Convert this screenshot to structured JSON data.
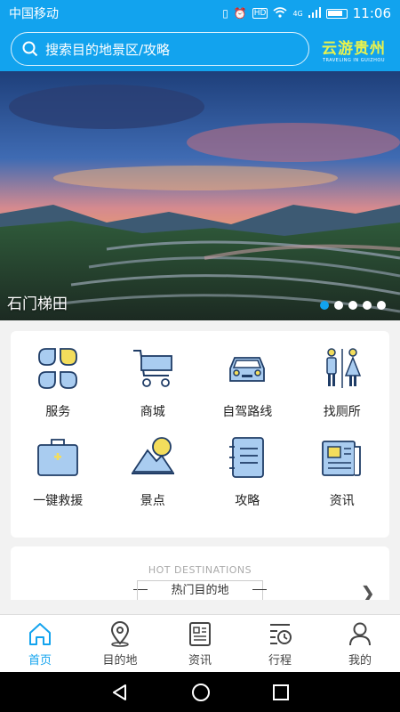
{
  "status": {
    "carrier": "中国移动",
    "time": "11:06",
    "hd": "HD",
    "net": "4G"
  },
  "search": {
    "placeholder": "搜索目的地景区/攻略"
  },
  "brand": {
    "name": "云游贵州",
    "tagline": "TRAVELING IN GUIZHOU"
  },
  "banner": {
    "caption": "石门梯田",
    "dot_count": 5,
    "active_dot": 0
  },
  "services": [
    {
      "label": "服务",
      "icon": "services-icon"
    },
    {
      "label": "商城",
      "icon": "cart-icon"
    },
    {
      "label": "自驾路线",
      "icon": "car-icon"
    },
    {
      "label": "找厕所",
      "icon": "restroom-icon"
    },
    {
      "label": "一键救援",
      "icon": "first-aid-icon"
    },
    {
      "label": "景点",
      "icon": "mountain-icon"
    },
    {
      "label": "攻略",
      "icon": "notebook-icon"
    },
    {
      "label": "资讯",
      "icon": "news-icon"
    }
  ],
  "hot": {
    "en": "HOT DESTINATIONS",
    "zh": "热门目的地"
  },
  "tabs": [
    {
      "label": "首页",
      "icon": "home-icon",
      "active": true
    },
    {
      "label": "目的地",
      "icon": "location-icon",
      "active": false
    },
    {
      "label": "资讯",
      "icon": "news-icon",
      "active": false
    },
    {
      "label": "行程",
      "icon": "itinerary-icon",
      "active": false
    },
    {
      "label": "我的",
      "icon": "profile-icon",
      "active": false
    }
  ],
  "colors": {
    "primary": "#12a3ee",
    "brand": "#e9f24d",
    "icon_fill": "#a9ccf0",
    "icon_accent": "#f3dd5c",
    "icon_stroke": "#1f3c66"
  }
}
